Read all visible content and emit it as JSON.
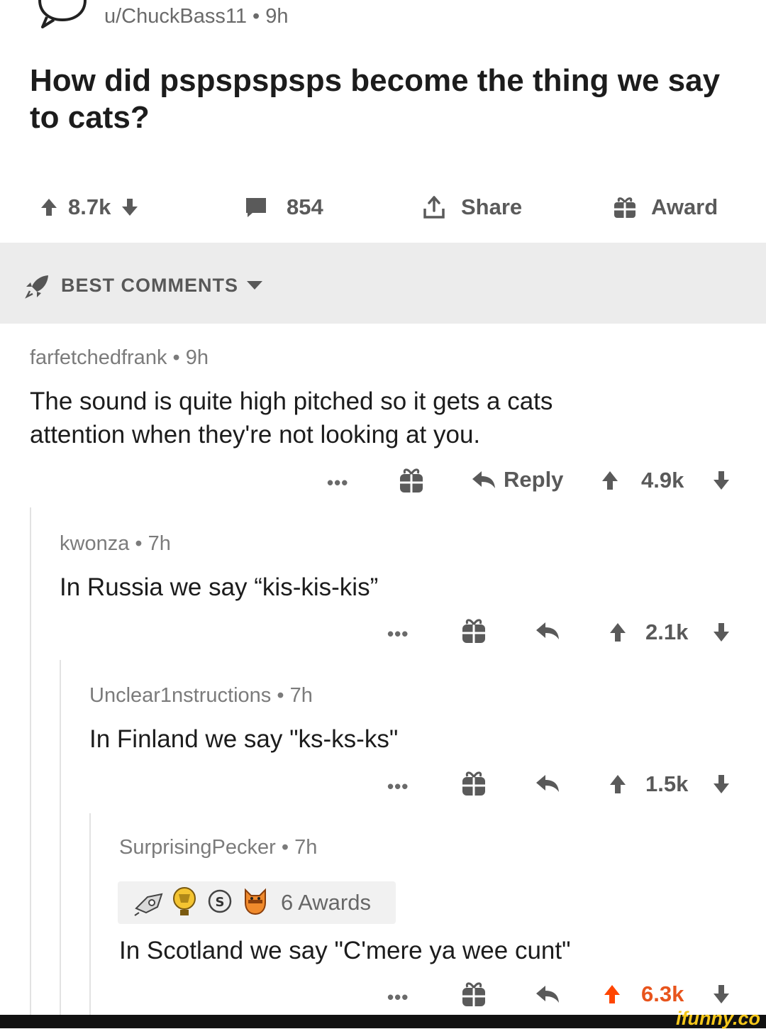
{
  "post": {
    "author": "u/ChuckBass11",
    "age": "9h",
    "title": "How did pspspspsps become the thing we say to cats?",
    "votes": "8.7k",
    "comments": "854",
    "share_label": "Share",
    "award_label": "Award"
  },
  "sort": {
    "label": "BEST COMMENTS"
  },
  "comments": [
    {
      "author": "farfetchedfrank",
      "age": "9h",
      "body": "The sound is quite high pitched so it gets a cats attention when they're not looking at you.",
      "reply_label": "Reply",
      "votes": "4.9k"
    },
    {
      "author": "kwonza",
      "age": "7h",
      "body": "In Russia we say “kis-kis-kis”",
      "votes": "2.1k"
    },
    {
      "author": "Unclear1nstructions",
      "age": "7h",
      "body": "In Finland we say \"ks-ks-ks\"",
      "votes": "1.5k"
    },
    {
      "author": "SurprisingPecker",
      "age": "7h",
      "awards": "6 Awards",
      "body": "In Scotland we say \"C'mere ya wee cunt\"",
      "votes": "6.3k",
      "upvoted": true
    }
  ],
  "more_label": "•••",
  "separator": "•",
  "watermark": "ifunny.co",
  "colors": {
    "upvote_active": "#ff4500",
    "vote_inactive": "#5a5a5a",
    "brand": "#f5c71a"
  },
  "icons": [
    "speech-bubble-icon",
    "upvote-icon",
    "downvote-icon",
    "comment-icon",
    "share-icon",
    "gift-icon",
    "rocket-icon",
    "caret-down-icon",
    "reply-icon"
  ]
}
